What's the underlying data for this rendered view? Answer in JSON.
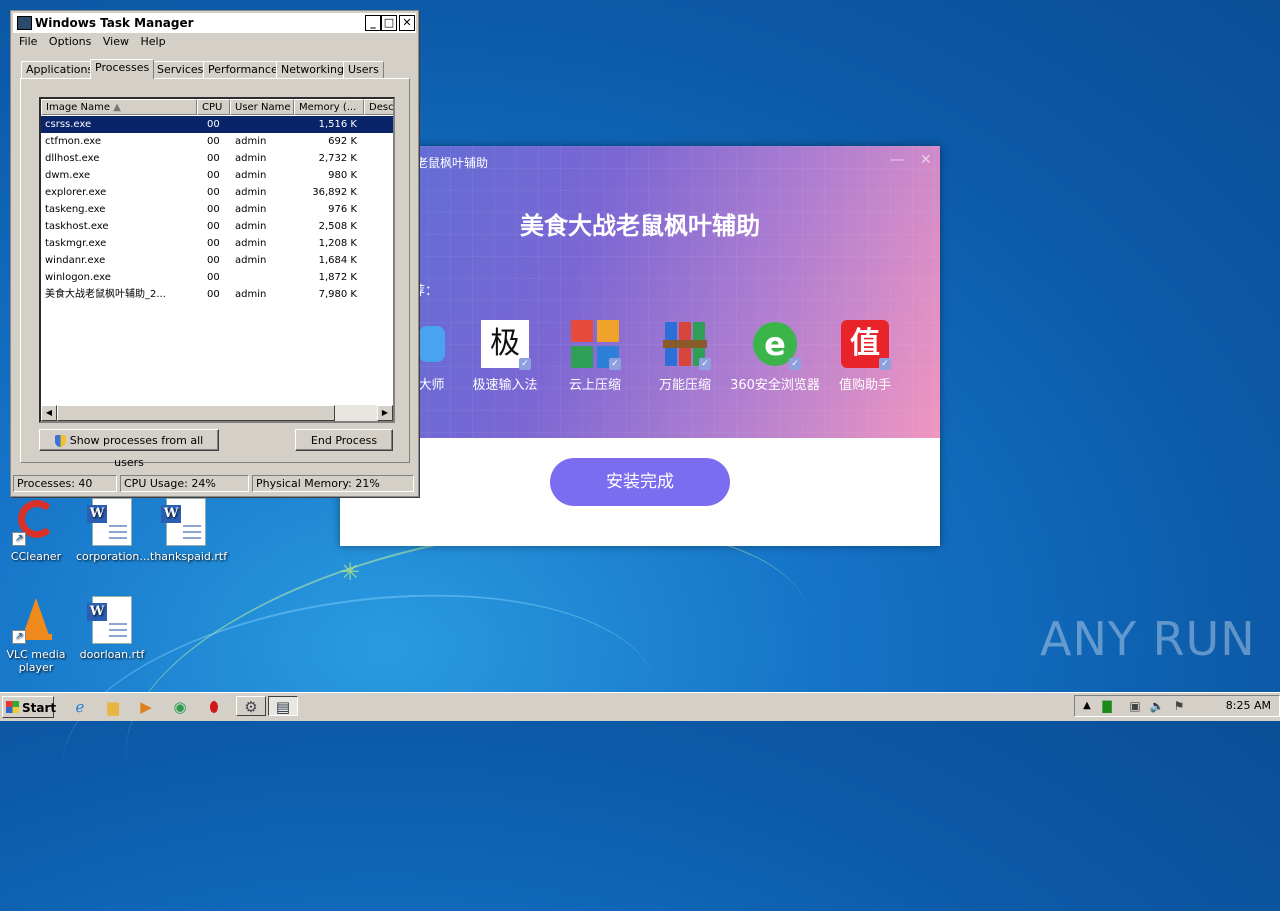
{
  "desktop": {
    "icons": [
      {
        "label": "CCleaner"
      },
      {
        "label": "corporation..."
      },
      {
        "label": "thankspaid.rtf"
      },
      {
        "label": "VLC media player"
      },
      {
        "label": "doorloan.rtf"
      }
    ],
    "watermark": "ANY RUN"
  },
  "installer": {
    "window_title": "老鼠枫叶辅助",
    "headline": "美食大战老鼠枫叶辅助",
    "recommend_label": "荐：",
    "apps": [
      {
        "label": "似大师"
      },
      {
        "label": "极速输入法",
        "glyph": "极"
      },
      {
        "label": "云上压缩"
      },
      {
        "label": "万能压缩"
      },
      {
        "label": "360安全浏览器"
      },
      {
        "label": "值购助手",
        "glyph": "值"
      }
    ],
    "done_button": "安装完成"
  },
  "task_manager": {
    "title": "Windows Task Manager",
    "menu": [
      "File",
      "Options",
      "View",
      "Help"
    ],
    "tabs": [
      "Applications",
      "Processes",
      "Services",
      "Performance",
      "Networking",
      "Users"
    ],
    "active_tab": "Processes",
    "columns": [
      "Image Name",
      "CPU",
      "User Name",
      "Memory (...",
      "Desc"
    ],
    "rows": [
      {
        "name": "csrss.exe",
        "cpu": "00",
        "user": "",
        "mem": "1,516 K"
      },
      {
        "name": "ctfmon.exe",
        "cpu": "00",
        "user": "admin",
        "mem": "692 K"
      },
      {
        "name": "dllhost.exe",
        "cpu": "00",
        "user": "admin",
        "mem": "2,732 K"
      },
      {
        "name": "dwm.exe",
        "cpu": "00",
        "user": "admin",
        "mem": "980 K"
      },
      {
        "name": "explorer.exe",
        "cpu": "00",
        "user": "admin",
        "mem": "36,892 K"
      },
      {
        "name": "taskeng.exe",
        "cpu": "00",
        "user": "admin",
        "mem": "976 K"
      },
      {
        "name": "taskhost.exe",
        "cpu": "00",
        "user": "admin",
        "mem": "2,508 K"
      },
      {
        "name": "taskmgr.exe",
        "cpu": "00",
        "user": "admin",
        "mem": "1,208 K"
      },
      {
        "name": "windanr.exe",
        "cpu": "00",
        "user": "admin",
        "mem": "1,684 K"
      },
      {
        "name": "winlogon.exe",
        "cpu": "00",
        "user": "",
        "mem": "1,872 K"
      },
      {
        "name": "美食大战老鼠枫叶辅助_2...",
        "cpu": "00",
        "user": "admin",
        "mem": "7,980 K"
      }
    ],
    "show_all_button": "Show processes from all users",
    "end_process_button": "End Process",
    "status": {
      "processes": "Processes: 40",
      "cpu": "CPU Usage: 24%",
      "memory": "Physical Memory: 21%"
    }
  },
  "taskbar": {
    "start_label": "Start",
    "clock": "8:25 AM"
  }
}
